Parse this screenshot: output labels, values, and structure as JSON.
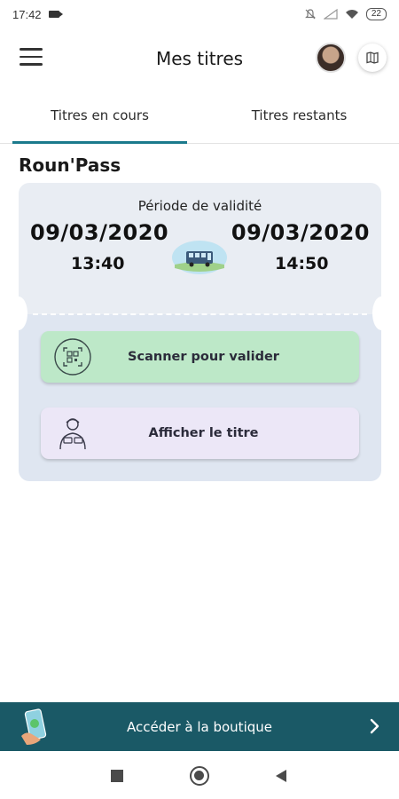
{
  "status_bar": {
    "time": "17:42",
    "battery": "22"
  },
  "app_bar": {
    "title": "Mes titres"
  },
  "tabs": [
    {
      "label": "Titres en cours",
      "active": true
    },
    {
      "label": "Titres restants",
      "active": false
    }
  ],
  "pass": {
    "name": "Roun'Pass",
    "validity_label": "Période de validité",
    "start_date": "09/03/2020",
    "start_time": "13:40",
    "end_date": "09/03/2020",
    "end_time": "14:50"
  },
  "actions": {
    "scan_label": "Scanner pour valider",
    "show_label": "Afficher le titre"
  },
  "shop": {
    "label": "Accéder à la boutique"
  },
  "colors": {
    "accent": "#1b7a8c",
    "shop_bar": "#1a5966",
    "scan_button": "#bde8c8",
    "show_button": "#ece7f7",
    "ticket": "#e9edf3"
  }
}
